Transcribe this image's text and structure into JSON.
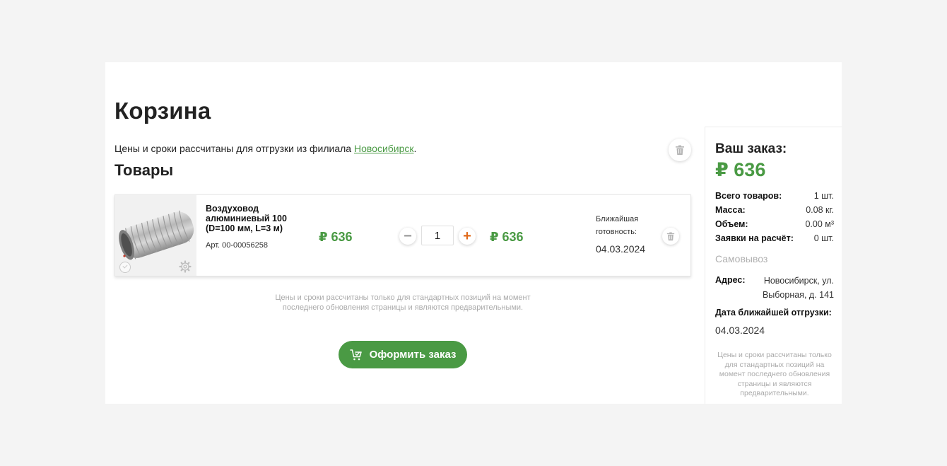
{
  "page": {
    "title": "Корзина",
    "branch_note_prefix": "Цены и сроки рассчитаны для отгрузки из филиала ",
    "branch_link": "Новосибирск",
    "branch_note_suffix": ".",
    "section_title": "Товары",
    "clear_icon": "trash-icon"
  },
  "cart_item": {
    "name": "Воздуховод алюминиевый 100 (D=100 мм, L=3 м)",
    "sku": "Арт. 00-00056258",
    "unit_price": "₽ 636",
    "quantity": "1",
    "total_price": "₽ 636",
    "ready_label": "Ближайшая готовность:",
    "ready_date": "04.03.2024",
    "minus_symbol": "−",
    "plus_symbol": "+"
  },
  "disclaimer": "Цены и сроки рассчитаны только для стандартных позиций на момент последнего обновления страницы и являются предварительными.",
  "checkout": {
    "label": "Оформить заказ",
    "icon": "cart-check-icon"
  },
  "summary": {
    "title": "Ваш заказ:",
    "total": "₽ 636",
    "stats": [
      {
        "label": "Всего товаров:",
        "value": "1 шт."
      },
      {
        "label": "Масса:",
        "value": "0.08 кг."
      },
      {
        "label": "Объем:",
        "value": "0.00 м³"
      },
      {
        "label": "Заявки на расчёт:",
        "value": "0 шт."
      }
    ],
    "delivery_method": "Самовывоз",
    "address_label": "Адрес:",
    "address_value": "Новосибирск, ул. Выборная, д. 141",
    "ship_label": "Дата ближайшей отгрузки:",
    "ship_date": "04.03.2024",
    "disclaimer": "Цены и сроки рассчитаны только для стандартных позиций на момент последнего обновления страницы и являются предварительными."
  },
  "colors": {
    "accent": "#4a9a44",
    "plus": "#e06a1a",
    "muted": "#aaaaaa",
    "background": "#f4f4f4"
  }
}
